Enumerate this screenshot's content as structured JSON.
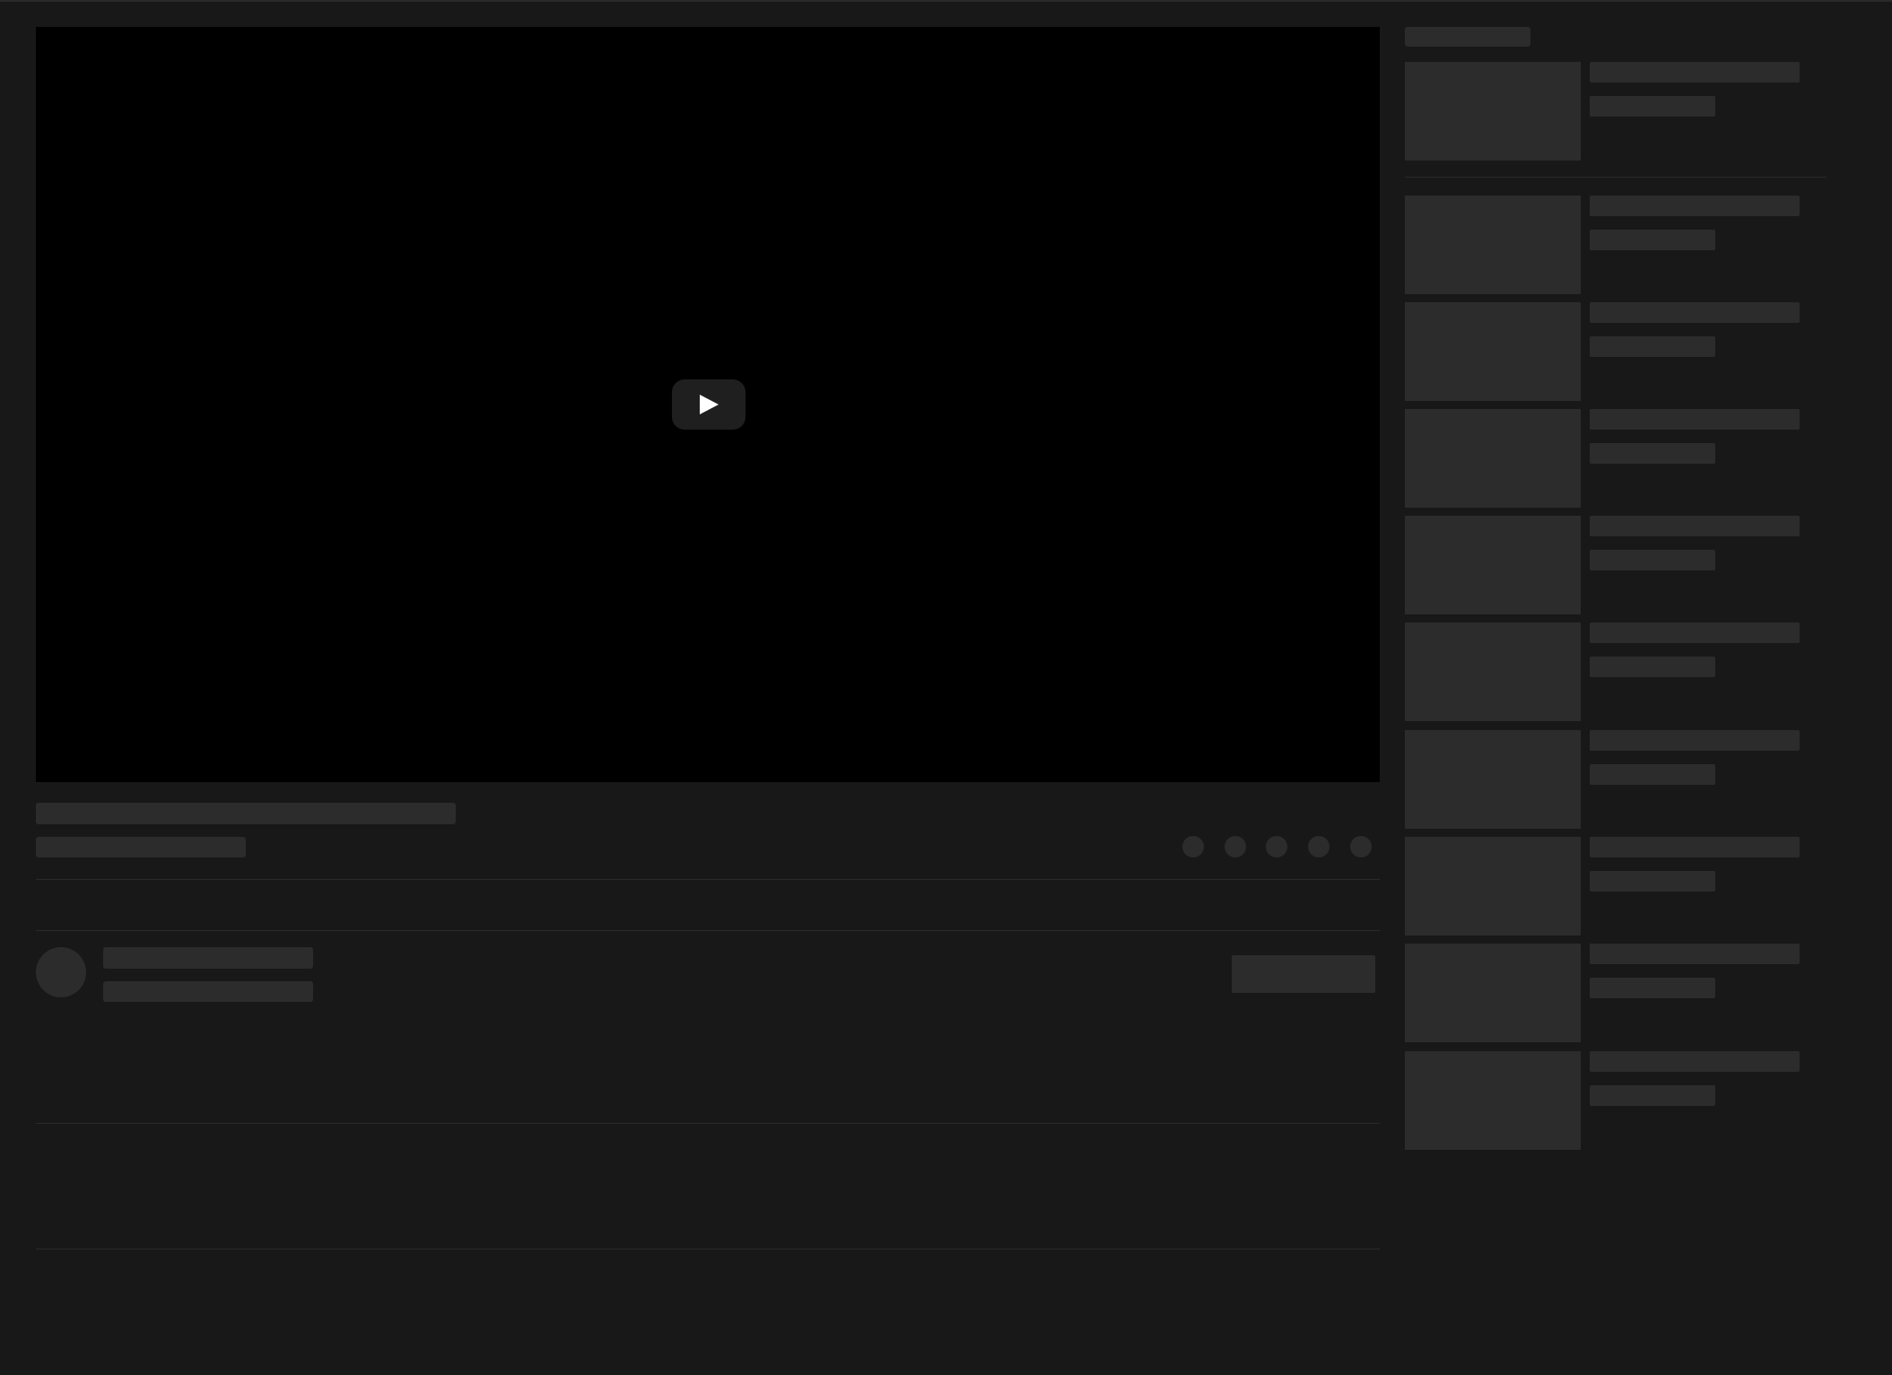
{
  "theme": {
    "background": "#181818",
    "placeholder": "#2c2c2c",
    "player_background": "#000000",
    "play_button_background": "#1f1f1f",
    "play_icon_color": "#ffffff",
    "divider": "#2a2a2a"
  },
  "icons": {
    "play": "play-icon",
    "actions": [
      "action-icon-1",
      "action-icon-2",
      "action-icon-3",
      "action-icon-4",
      "action-icon-5"
    ]
  },
  "sidebar": {
    "recommendation_count": 10
  }
}
